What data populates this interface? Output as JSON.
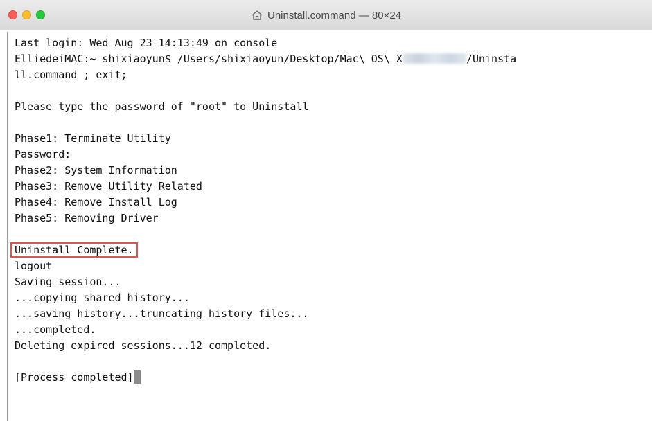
{
  "window": {
    "title": "Uninstall.command — 80×24",
    "icon": "home-icon"
  },
  "terminal": {
    "lines": [
      "Last login: Wed Aug 23 14:13:49 on console",
      "ElliedeiMAC:~ shixiaoyun$ /Users/shixiaoyun/Desktop/Mac\\ OS\\ X",
      "/Uninsta",
      "ll.command ; exit;",
      "",
      "Please type the password of \"root\" to Uninstall",
      "",
      "Phase1: Terminate Utility",
      "Password:",
      "Phase2: System Information",
      "Phase3: Remove Utility Related",
      "Phase4: Remove Install Log",
      "Phase5: Removing Driver",
      "",
      "Uninstall Complete.",
      "logout",
      "Saving session...",
      "...copying shared history...",
      "...saving history...truncating history files...",
      "...completed.",
      "Deleting expired sessions...12 completed.",
      "",
      "[Process completed]"
    ]
  },
  "colors": {
    "highlight_box": "#e0554b",
    "close": "#fc5f57",
    "minimize": "#fdbc2e",
    "maximize": "#28c840"
  }
}
